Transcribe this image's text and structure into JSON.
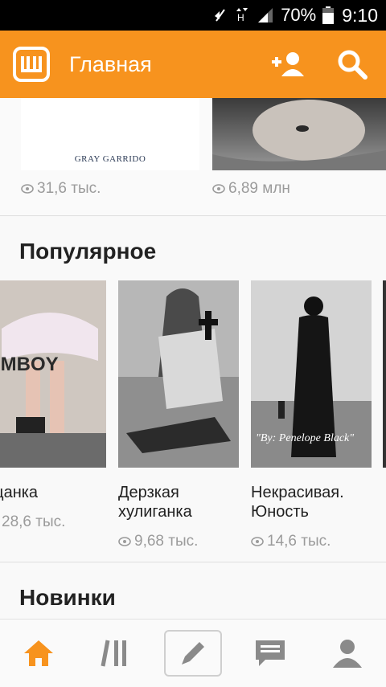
{
  "status_bar": {
    "battery": "70%",
    "time": "9:10"
  },
  "app_bar": {
    "title": "Главная"
  },
  "top_cards": [
    {
      "cover_text": "GRAY GARRIDO",
      "views": "31,6 тыс."
    },
    {
      "cover_text": "",
      "views": "6,89 млн"
    }
  ],
  "popular": {
    "title": "Популярное",
    "books": [
      {
        "cover_text": "OMBOY",
        "title": "ацанка",
        "views": "28,6 тыс."
      },
      {
        "cover_text": "",
        "title": "Дерзкая хулиганка",
        "views": "9,68 тыс."
      },
      {
        "cover_text": "\"By: Penelope Black\"",
        "title": "Некрасивая. Юность",
        "views": "14,6 тыс."
      }
    ]
  },
  "new": {
    "title": "Новинки"
  },
  "colors": {
    "brand": "#f7931e",
    "text": "#222222",
    "muted": "#9b9b9b"
  },
  "icons": [
    "mute-icon",
    "signal-icon",
    "battery-icon",
    "logo-icon",
    "add-user-icon",
    "search-icon",
    "home-icon",
    "library-icon",
    "compose-icon",
    "messages-icon",
    "profile-icon",
    "eye-icon"
  ]
}
